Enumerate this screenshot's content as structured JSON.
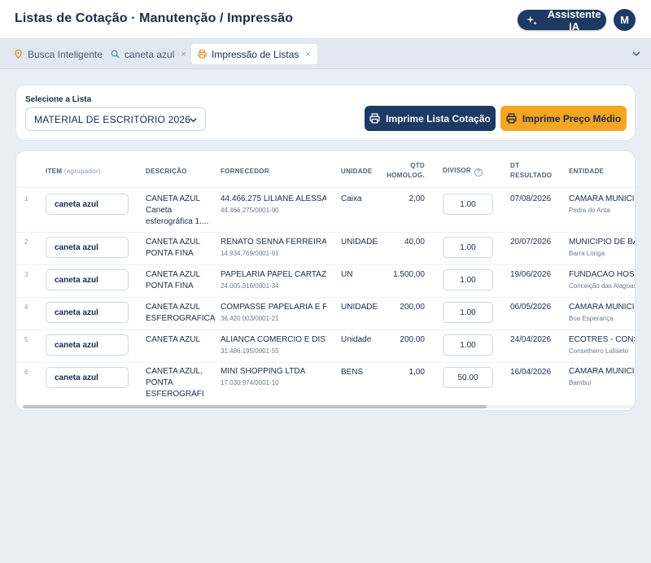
{
  "header": {
    "title": "Listas de Cotação · Manutenção / Impressão",
    "ai_button": "Assistente IA",
    "avatar": "M"
  },
  "tabs": [
    {
      "label": "Busca Inteligente",
      "icon": "pin-icon",
      "closable": false
    },
    {
      "label": "caneta azul",
      "icon": "search-icon",
      "closable": true
    },
    {
      "label": "Impressão de Listas",
      "icon": "printer-icon",
      "closable": true,
      "active": true
    }
  ],
  "tab_close": "×",
  "list_panel": {
    "label": "Selecione a Lista",
    "selected": "MATERIAL DE ESCRITÓRIO 2026",
    "print_list_button": "Imprime Lista Cotação",
    "print_avg_button": "Imprime Preço Médio"
  },
  "table": {
    "headers": {
      "item": "ITEM",
      "item_sub": "(agrupador)",
      "descricao": "DESCRIÇÃO",
      "fornecedor": "FORNECEDOR",
      "unidade": "UNIDADE",
      "qtd1": "QTD",
      "qtd2": "HOMOLOG.",
      "divisor": "DIVISOR",
      "divisor_help": "?",
      "dt1": "DT",
      "dt2": "RESULTADO",
      "entidade": "ENTIDADE"
    },
    "rows": [
      {
        "n": "1",
        "item": "caneta azul",
        "desc": "CANETA AZUL Caneta esferográfica 1....",
        "forn": "44.466.275 LILIANE ALESSA...",
        "cnpj": "44.466.275/0001-90",
        "unid": "Caixa",
        "qtd": "2,00",
        "divisor": "1.00",
        "dt": "07/08/2026",
        "ent": "CAMARA MUNICIPAL",
        "city": "Pedra do Anta"
      },
      {
        "n": "2",
        "item": "caneta azul",
        "desc": "CANETA AZUL PONTA FINA",
        "forn": "RENATO SENNA FERREIRA",
        "cnpj": "14.934.769/0001-91",
        "unid": "UNIDADE",
        "qtd": "40,00",
        "divisor": "1.00",
        "dt": "20/07/2026",
        "ent": "MUNICIPIO DE BARR",
        "city": "Barra Longa"
      },
      {
        "n": "3",
        "item": "caneta azul",
        "desc": "CANETA AZUL PONTA FINA",
        "forn": "PAPELARIA PAPEL CARTAZ L...",
        "cnpj": "24.005.316/0001-34",
        "unid": "UN",
        "qtd": "1.500,00",
        "divisor": "1.00",
        "dt": "19/06/2026",
        "ent": "FUNDACAO HOSPITA",
        "city": "Conceição das Alagoas"
      },
      {
        "n": "4",
        "item": "caneta azul",
        "desc": "CANETA AZUL ESFEROGRAFICA",
        "forn": "COMPASSE PAPELARIA E RE...",
        "cnpj": "36.420.003/0001-21",
        "unid": "UNIDADE",
        "qtd": "200,00",
        "divisor": "1.00",
        "dt": "06/05/2026",
        "ent": "CAMARA MUNICIPAL",
        "city": "Boa Esperança"
      },
      {
        "n": "5",
        "item": "caneta azul",
        "desc": "CANETA AZUL",
        "forn": "ALIANCA COMERCIO E DIST...",
        "cnpj": "31.486.195/0001-55",
        "unid": "Unidade",
        "qtd": "200,00",
        "divisor": "1.00",
        "dt": "24/04/2026",
        "ent": "ECOTRES - CONSORC",
        "city": "Conselheiro Lafaiete"
      },
      {
        "n": "6",
        "item": "caneta azul",
        "desc": "CANETA AZUL, PONTA ESFEROGRÁFI...",
        "forn": "MINI SHOPPING LTDA",
        "cnpj": "17.030.974/0001-10",
        "unid": "BENS",
        "qtd": "1,00",
        "divisor": "50.00",
        "dt": "16/04/2026",
        "ent": "CAMARA MUNICIPAL",
        "city": "Bambuí"
      }
    ]
  },
  "colors": {
    "primary": "#1c3a63",
    "accent": "#f6a623",
    "background": "#e9eef5"
  }
}
